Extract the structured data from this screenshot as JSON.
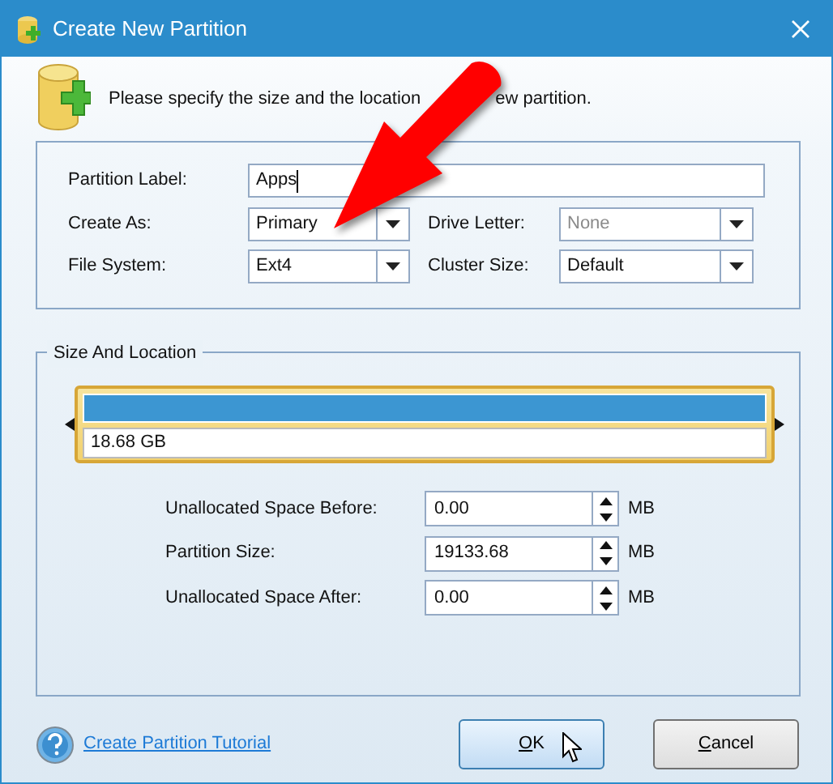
{
  "window": {
    "title": "Create New Partition"
  },
  "instruction_parts": [
    "Please specify the size and the location",
    "ew partition."
  ],
  "settings_rows": [
    [
      {
        "label": "Partition Label:",
        "kind": "text",
        "value": "Apps",
        "focused": true,
        "disabled": false
      }
    ],
    [
      {
        "label": "Create As:",
        "kind": "combo",
        "value": "Primary",
        "disabled": false
      },
      {
        "label": "Drive Letter:",
        "kind": "combo",
        "value": "None",
        "disabled": true
      }
    ],
    [
      {
        "label": "File System:",
        "kind": "combo",
        "value": "Ext4",
        "disabled": false
      },
      {
        "label": "Cluster Size:",
        "kind": "combo",
        "value": "Default",
        "disabled": false
      }
    ]
  ],
  "size_and_location": {
    "title": "Size And Location",
    "partition_bar": {
      "size": "18.68 GB",
      "level": 1
    },
    "fields": [
      {
        "label": "Unallocated Space Before:",
        "value": "0.00",
        "unit": "MB"
      },
      {
        "label": "Partition Size:",
        "value": "19133.68",
        "unit": "MB"
      },
      {
        "label": "Unallocated Space After:",
        "value": "0.00",
        "unit": "MB"
      }
    ]
  },
  "help_link": "Create Partition Tutorial",
  "buttons": [
    {
      "label": "OK",
      "default": true,
      "mnemonic_underlined": true
    },
    {
      "label": "Cancel",
      "default": false,
      "mnemonic_underlined": true
    }
  ]
}
